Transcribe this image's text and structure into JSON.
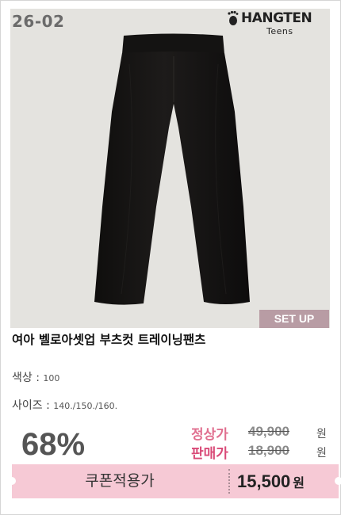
{
  "product": {
    "code": "26-02",
    "brand_main": "HANGTEN",
    "brand_sub": "Teens",
    "badge": "SET UP",
    "title": "여아 벨로아셋업 부츠컷 트레이닝팬츠"
  },
  "options": {
    "color_label": "색상 :",
    "color_value": "100",
    "size_label": "사이즈 :",
    "size_value": "140./150./160."
  },
  "pricing": {
    "discount": "68%",
    "regular_label": "정상가",
    "regular_price": "49,900",
    "sale_label": "판매가",
    "sale_price": "18,900",
    "currency": "원",
    "coupon_label": "쿠폰적용가",
    "coupon_price": "15,500",
    "coupon_currency": "원"
  },
  "colors": {
    "regular_label": "#e06f8f",
    "sale_label": "#d94b78",
    "coupon_bg": "#f6c9d5",
    "badge_bg": "#b89ca4",
    "product": "#151312"
  }
}
